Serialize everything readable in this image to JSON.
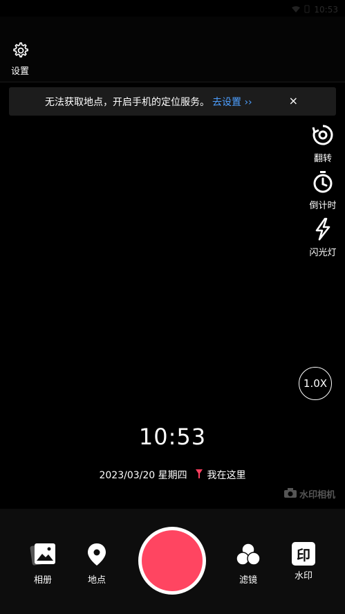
{
  "status": {
    "time": "10:53"
  },
  "top": {
    "settings_label": "设置"
  },
  "banner": {
    "message": "无法获取地点，开启手机的定位服务。",
    "link": "去设置 ››",
    "close": "×"
  },
  "side_tools": [
    {
      "label": "翻转",
      "icon": "flip-camera-icon"
    },
    {
      "label": "倒计时",
      "icon": "timer-icon"
    },
    {
      "label": "闪光灯",
      "icon": "flash-icon"
    }
  ],
  "zoom": "1.0X",
  "overlay": {
    "time": "10:53",
    "date": "2023/03/20 星期四",
    "location": "我在这里"
  },
  "watermark_brand": "水印相机",
  "bottom": {
    "album": "相册",
    "location": "地点",
    "filter": "滤镜",
    "watermark": "水印",
    "watermark_icon_text": "印"
  },
  "colors": {
    "shutter": "#ff4561",
    "link": "#4d9fff",
    "pin": "#ff4060"
  }
}
